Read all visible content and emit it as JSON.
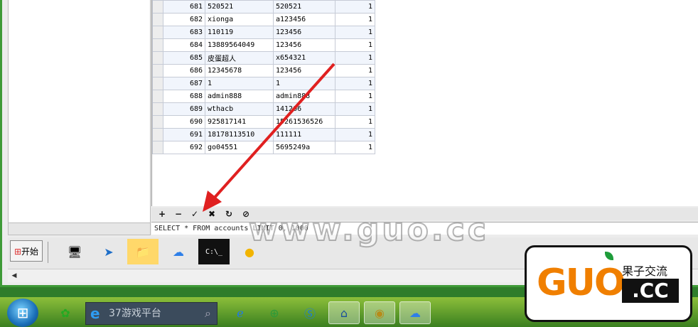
{
  "table": {
    "rows": [
      {
        "id": "681",
        "user": "520521",
        "pass": "520521",
        "flag": "1"
      },
      {
        "id": "682",
        "user": "xionga",
        "pass": "a123456",
        "flag": "1"
      },
      {
        "id": "683",
        "user": "110119",
        "pass": "123456",
        "flag": "1"
      },
      {
        "id": "684",
        "user": "13889564049",
        "pass": "123456",
        "flag": "1"
      },
      {
        "id": "685",
        "user": "皮蛋超人",
        "pass": "x654321",
        "flag": "1"
      },
      {
        "id": "686",
        "user": "12345678",
        "pass": "123456",
        "flag": "1"
      },
      {
        "id": "687",
        "user": "1",
        "pass": "1",
        "flag": "1"
      },
      {
        "id": "688",
        "user": "admin888",
        "pass": "admin888",
        "flag": "1"
      },
      {
        "id": "689",
        "user": "wthacb",
        "pass": "141206",
        "flag": "1"
      },
      {
        "id": "690",
        "user": "925817141",
        "pass": "15261536526",
        "flag": "1"
      },
      {
        "id": "691",
        "user": "18178113510",
        "pass": "111111",
        "flag": "1"
      },
      {
        "id": "692",
        "user": "go04551",
        "pass": "5695249a",
        "flag": "1"
      }
    ]
  },
  "toolbar": {
    "add": "+",
    "remove": "−",
    "apply": "✓",
    "cancel": "✖",
    "refresh": "↻",
    "stop": "⊘"
  },
  "sql": "SELECT * FROM accounts LIMIT 0, 1000",
  "quicklaunch": {
    "start_label": "开始"
  },
  "taskbar": {
    "search_text": "37游戏平台"
  },
  "watermark": "www.guo.cc",
  "logo": {
    "big_text": "GUO",
    "cn_text": "果子交流",
    "cc_text": ".CC"
  }
}
